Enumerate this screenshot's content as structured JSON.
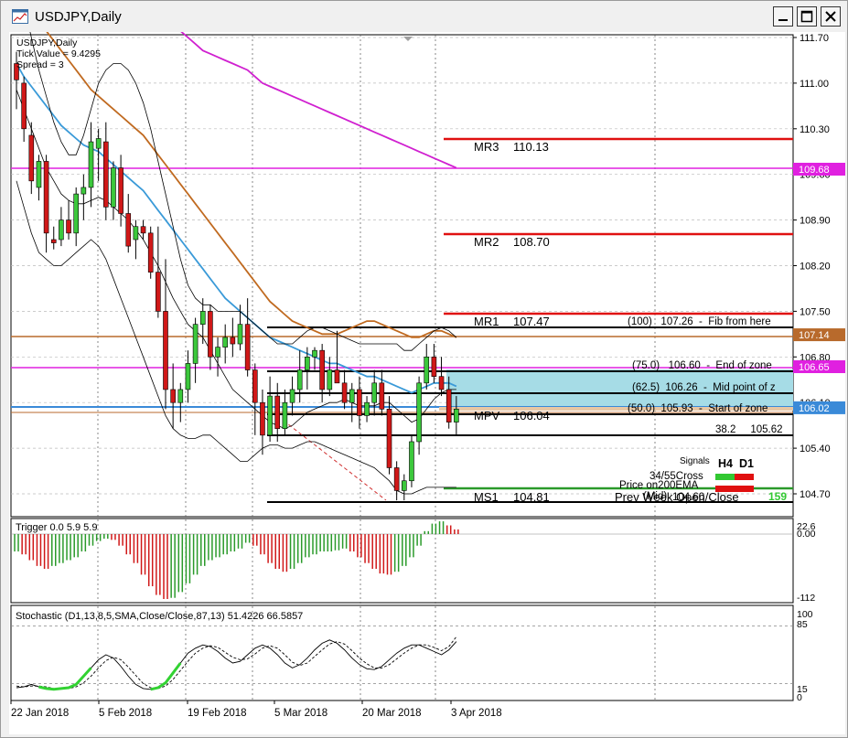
{
  "window": {
    "title": "USDJPY,Daily"
  },
  "chart_data": {
    "type": "candlestick",
    "symbol": "USDJPY,Daily",
    "info_lines": [
      "USDJPY,Daily",
      "Tick Value = 9.4295",
      "Spread = 3"
    ],
    "price_axis": {
      "ticks": [
        "111.70",
        "111.00",
        "110.30",
        "109.60",
        "108.90",
        "108.20",
        "107.50",
        "106.80",
        "106.10",
        "105.40",
        "104.70"
      ],
      "highlighted": [
        {
          "label": "109.68",
          "color": "#e020e0"
        },
        {
          "label": "107.14",
          "color": "#b86a2c"
        },
        {
          "label": "106.65",
          "color": "#e020e0"
        },
        {
          "label": "106.02",
          "color": "#3a8ad8"
        }
      ]
    },
    "date_axis": [
      "22 Jan 2018",
      "5 Feb 2018",
      "19 Feb 2018",
      "5 Mar 2018",
      "20 Mar 2018",
      "3 Apr 2018"
    ],
    "pivot_levels": [
      {
        "label": "MR3",
        "value": "110.13"
      },
      {
        "label": "MR2",
        "value": "108.70"
      },
      {
        "label": "MR1",
        "value": "107.47"
      },
      {
        "label": "MPV",
        "value": "106.04"
      },
      {
        "label": "MS1",
        "value": "104.81"
      }
    ],
    "fib_labels": [
      "(100)   107.26  -  Fib from here",
      "(75.0)   106.60  -  End of zone",
      "(62.5)  106.26  -  Mid point of z",
      "(50.0)  105.93  -  Start of zone",
      "38.2     105.62"
    ],
    "signals": {
      "title": "Signals",
      "columns": [
        "H4",
        "D1"
      ],
      "rows": [
        {
          "label": "34/55Cross",
          "h4": "#32c832",
          "d1": "#e01010"
        },
        {
          "label": "Price on200EMA",
          "h4": "#e01010",
          "d1": "#e01010"
        }
      ],
      "prev_week_text": "Prev Week Open/Close",
      "prev_week_value": "104.60",
      "prev_week_extra": "(Mid)",
      "prev_week_badge": "159"
    },
    "trigger_panel": {
      "label": "Trigger 0.0 5.9 5.9",
      "ticks": [
        "22.6",
        "0.00",
        "-112"
      ]
    },
    "stochastic_panel": {
      "label": "Stochastic (D1,13,8,5,SMA,Close/Close,87,13) 51.4226 66.5857",
      "ticks": [
        "100",
        "85",
        "15",
        "0"
      ]
    },
    "candles": [
      {
        "o": 111.3,
        "h": 111.48,
        "l": 110.6,
        "c": 111.05
      },
      {
        "o": 111.0,
        "h": 111.1,
        "l": 110.1,
        "c": 110.3
      },
      {
        "o": 110.2,
        "h": 110.4,
        "l": 109.3,
        "c": 109.5
      },
      {
        "o": 109.4,
        "h": 109.9,
        "l": 109.2,
        "c": 109.8
      },
      {
        "o": 109.8,
        "h": 109.9,
        "l": 108.4,
        "c": 108.7
      },
      {
        "o": 108.6,
        "h": 108.8,
        "l": 108.45,
        "c": 108.55
      },
      {
        "o": 108.6,
        "h": 109.1,
        "l": 108.5,
        "c": 108.9
      },
      {
        "o": 108.9,
        "h": 109.2,
        "l": 108.6,
        "c": 108.7
      },
      {
        "o": 108.7,
        "h": 109.4,
        "l": 108.5,
        "c": 109.3
      },
      {
        "o": 109.3,
        "h": 109.6,
        "l": 108.9,
        "c": 109.4
      },
      {
        "o": 109.4,
        "h": 110.4,
        "l": 109.1,
        "c": 110.1
      },
      {
        "o": 110.0,
        "h": 110.3,
        "l": 109.5,
        "c": 110.15
      },
      {
        "o": 110.1,
        "h": 110.4,
        "l": 108.9,
        "c": 109.1
      },
      {
        "o": 109.1,
        "h": 109.8,
        "l": 108.9,
        "c": 109.7
      },
      {
        "o": 109.7,
        "h": 109.9,
        "l": 108.8,
        "c": 109.0
      },
      {
        "o": 109.0,
        "h": 109.3,
        "l": 108.4,
        "c": 108.5
      },
      {
        "o": 108.6,
        "h": 108.9,
        "l": 108.3,
        "c": 108.8
      },
      {
        "o": 108.8,
        "h": 108.9,
        "l": 108.6,
        "c": 108.7
      },
      {
        "o": 108.7,
        "h": 108.8,
        "l": 108.0,
        "c": 108.1
      },
      {
        "o": 108.1,
        "h": 108.8,
        "l": 107.4,
        "c": 107.5
      },
      {
        "o": 107.5,
        "h": 108.3,
        "l": 106.0,
        "c": 106.3
      },
      {
        "o": 106.3,
        "h": 106.7,
        "l": 105.7,
        "c": 106.1
      },
      {
        "o": 106.1,
        "h": 106.4,
        "l": 105.8,
        "c": 106.3
      },
      {
        "o": 106.3,
        "h": 106.9,
        "l": 106.1,
        "c": 106.7
      },
      {
        "o": 106.7,
        "h": 107.4,
        "l": 106.4,
        "c": 107.3
      },
      {
        "o": 107.3,
        "h": 107.7,
        "l": 107.0,
        "c": 107.5
      },
      {
        "o": 107.5,
        "h": 107.6,
        "l": 106.6,
        "c": 106.8
      },
      {
        "o": 106.8,
        "h": 107.1,
        "l": 106.5,
        "c": 106.95
      },
      {
        "o": 106.95,
        "h": 107.3,
        "l": 106.7,
        "c": 107.1
      },
      {
        "o": 107.1,
        "h": 107.4,
        "l": 106.8,
        "c": 107.0
      },
      {
        "o": 107.0,
        "h": 107.6,
        "l": 106.9,
        "c": 107.3
      },
      {
        "o": 107.3,
        "h": 107.7,
        "l": 106.5,
        "c": 106.6
      },
      {
        "o": 106.6,
        "h": 106.7,
        "l": 105.6,
        "c": 106.1
      },
      {
        "o": 106.1,
        "h": 106.3,
        "l": 105.3,
        "c": 105.6
      },
      {
        "o": 105.6,
        "h": 106.5,
        "l": 105.5,
        "c": 106.2
      },
      {
        "o": 106.2,
        "h": 106.4,
        "l": 105.5,
        "c": 105.7
      },
      {
        "o": 105.7,
        "h": 106.3,
        "l": 105.6,
        "c": 106.1
      },
      {
        "o": 106.1,
        "h": 106.5,
        "l": 105.9,
        "c": 106.3
      },
      {
        "o": 106.3,
        "h": 106.9,
        "l": 106.1,
        "c": 106.6
      },
      {
        "o": 106.6,
        "h": 106.95,
        "l": 106.3,
        "c": 106.8
      },
      {
        "o": 106.8,
        "h": 106.95,
        "l": 106.6,
        "c": 106.9
      },
      {
        "o": 106.9,
        "h": 107.0,
        "l": 106.1,
        "c": 106.3
      },
      {
        "o": 106.3,
        "h": 106.8,
        "l": 106.2,
        "c": 106.6
      },
      {
        "o": 106.6,
        "h": 107.2,
        "l": 106.4,
        "c": 106.4
      },
      {
        "o": 106.4,
        "h": 106.6,
        "l": 106.0,
        "c": 106.1
      },
      {
        "o": 106.1,
        "h": 106.4,
        "l": 105.8,
        "c": 106.3
      },
      {
        "o": 106.3,
        "h": 106.5,
        "l": 105.7,
        "c": 105.9
      },
      {
        "o": 105.9,
        "h": 106.2,
        "l": 105.8,
        "c": 106.1
      },
      {
        "o": 106.1,
        "h": 106.6,
        "l": 105.9,
        "c": 106.4
      },
      {
        "o": 106.4,
        "h": 106.6,
        "l": 105.9,
        "c": 106.0
      },
      {
        "o": 106.0,
        "h": 106.2,
        "l": 105.0,
        "c": 105.1
      },
      {
        "o": 105.1,
        "h": 105.2,
        "l": 104.6,
        "c": 104.75
      },
      {
        "o": 104.75,
        "h": 105.0,
        "l": 104.6,
        "c": 104.9
      },
      {
        "o": 104.9,
        "h": 105.6,
        "l": 104.8,
        "c": 105.5
      },
      {
        "o": 105.5,
        "h": 106.5,
        "l": 105.3,
        "c": 106.4
      },
      {
        "o": 106.4,
        "h": 107.0,
        "l": 106.3,
        "c": 106.8
      },
      {
        "o": 106.8,
        "h": 107.0,
        "l": 106.4,
        "c": 106.5
      },
      {
        "o": 106.5,
        "h": 106.8,
        "l": 106.2,
        "c": 106.3
      },
      {
        "o": 106.3,
        "h": 106.5,
        "l": 105.7,
        "c": 105.8
      },
      {
        "o": 105.8,
        "h": 106.2,
        "l": 105.6,
        "c": 106.0
      }
    ],
    "ma_black": [
      110.9,
      110.6,
      110.3,
      110.0,
      109.7,
      109.5,
      109.3,
      109.2,
      109.15,
      109.15,
      109.2,
      109.25,
      109.2,
      109.1,
      109.0,
      108.9,
      108.75,
      108.6,
      108.4,
      108.2,
      107.95,
      107.7,
      107.5,
      107.3,
      107.2,
      107.1,
      106.9,
      106.7,
      106.5,
      106.3,
      106.2,
      106.1,
      106.0,
      105.9,
      105.8,
      105.75,
      105.7,
      105.75,
      105.85,
      105.95,
      106.0,
      106.05,
      106.1,
      106.1,
      106.15,
      106.1,
      106.05,
      106.05,
      106.05,
      106.1,
      106.1,
      106.0,
      105.9,
      105.8,
      105.85,
      106.0,
      106.15,
      106.25,
      106.3,
      106.3
    ],
    "ema_blue": [
      111.3,
      111.1,
      110.95,
      110.8,
      110.65,
      110.5,
      110.35,
      110.25,
      110.15,
      110.05,
      110.0,
      109.95,
      109.85,
      109.75,
      109.65,
      109.55,
      109.45,
      109.35,
      109.2,
      109.05,
      108.9,
      108.75,
      108.6,
      108.45,
      108.3,
      108.15,
      108.0,
      107.85,
      107.7,
      107.6,
      107.5,
      107.4,
      107.3,
      107.2,
      107.1,
      107.05,
      107.0,
      106.95,
      106.9,
      106.85,
      106.8,
      106.75,
      106.7,
      106.7,
      106.65,
      106.6,
      106.55,
      106.5,
      106.5,
      106.45,
      106.4,
      106.35,
      106.3,
      106.25,
      106.3,
      106.35,
      106.4,
      106.4,
      106.4,
      106.35
    ],
    "ema_brown": [
      112.5,
      112.3,
      112.1,
      111.95,
      111.8,
      111.65,
      111.5,
      111.35,
      111.2,
      111.05,
      110.9,
      110.8,
      110.7,
      110.6,
      110.5,
      110.4,
      110.3,
      110.2,
      110.05,
      109.9,
      109.75,
      109.6,
      109.45,
      109.3,
      109.15,
      109.0,
      108.85,
      108.7,
      108.55,
      108.4,
      108.25,
      108.1,
      107.95,
      107.8,
      107.65,
      107.55,
      107.45,
      107.35,
      107.3,
      107.25,
      107.2,
      107.15,
      107.15,
      107.15,
      107.2,
      107.25,
      107.3,
      107.35,
      107.35,
      107.3,
      107.25,
      107.2,
      107.15,
      107.1,
      107.1,
      107.15,
      107.2,
      107.2,
      107.15,
      107.1
    ],
    "ema_magenta": [
      113.6,
      113.5,
      113.4,
      113.3,
      113.2,
      113.1,
      113.0,
      112.9,
      112.8,
      112.75,
      112.7,
      112.65,
      112.6,
      112.55,
      112.5,
      112.45,
      112.4,
      112.3,
      112.2,
      112.1,
      112.0,
      111.9,
      111.8,
      111.7,
      111.6,
      111.5,
      111.45,
      111.4,
      111.35,
      111.3,
      111.25,
      111.2,
      111.1,
      111.0,
      110.95,
      110.9,
      110.85,
      110.8,
      110.75,
      110.7,
      110.65,
      110.6,
      110.55,
      110.5,
      110.45,
      110.4,
      110.35,
      110.3,
      110.25,
      110.2,
      110.15,
      110.1,
      110.05,
      110.0,
      109.95,
      109.9,
      109.85,
      109.8,
      109.75,
      109.7
    ],
    "env_upper": [
      112.6,
      112.2,
      111.7,
      111.2,
      110.8,
      110.4,
      110.1,
      109.9,
      109.9,
      110.2,
      110.6,
      111.0,
      111.2,
      111.3,
      111.3,
      111.2,
      111.0,
      110.7,
      110.3,
      109.8,
      109.3,
      108.8,
      108.3,
      107.9,
      107.7,
      107.6,
      107.6,
      107.5,
      107.5,
      107.5,
      107.5,
      107.4,
      107.3,
      107.2,
      107.1,
      107.0,
      107.0,
      107.0,
      107.1,
      107.2,
      107.25,
      107.25,
      107.2,
      107.15,
      107.1,
      107.05,
      107.0,
      107.0,
      107.0,
      107.0,
      107.0,
      107.0,
      106.9,
      106.9,
      107.0,
      107.1,
      107.2,
      107.25,
      107.2,
      107.1
    ],
    "env_lower": [
      109.5,
      109.1,
      108.7,
      108.4,
      108.3,
      108.2,
      108.2,
      108.3,
      108.4,
      108.5,
      108.6,
      108.5,
      108.3,
      108.0,
      107.7,
      107.4,
      107.1,
      106.8,
      106.5,
      106.2,
      105.9,
      105.7,
      105.6,
      105.55,
      105.55,
      105.6,
      105.6,
      105.5,
      105.4,
      105.3,
      105.2,
      105.2,
      105.3,
      105.4,
      105.45,
      105.45,
      105.4,
      105.4,
      105.45,
      105.5,
      105.5,
      105.45,
      105.4,
      105.35,
      105.3,
      105.25,
      105.2,
      105.15,
      105.1,
      105.0,
      104.9,
      104.75,
      104.7,
      104.7,
      104.75,
      104.8,
      104.8,
      104.8,
      104.8,
      104.8
    ],
    "trigger_hist": [
      -30,
      -35,
      -45,
      -55,
      -60,
      -55,
      -50,
      -45,
      -40,
      -30,
      -20,
      -12,
      -8,
      -10,
      -20,
      -35,
      -50,
      -70,
      -90,
      -105,
      -112,
      -110,
      -100,
      -85,
      -70,
      -55,
      -45,
      -40,
      -35,
      -30,
      -25,
      -15,
      -20,
      -35,
      -50,
      -60,
      -65,
      -60,
      -50,
      -40,
      -35,
      -30,
      -30,
      -28,
      -25,
      -30,
      -40,
      -50,
      -60,
      -68,
      -70,
      -65,
      -55,
      -40,
      -20,
      5,
      18,
      22,
      15,
      8
    ],
    "stoch_main": [
      10,
      11,
      14,
      11,
      9,
      8,
      9,
      10,
      14,
      24,
      34,
      44,
      50,
      46,
      36,
      24,
      14,
      9,
      8,
      10,
      16,
      28,
      40,
      52,
      58,
      62,
      60,
      54,
      46,
      40,
      42,
      50,
      58,
      62,
      58,
      50,
      40,
      34,
      38,
      46,
      56,
      64,
      68,
      64,
      56,
      46,
      38,
      33,
      32,
      36,
      44,
      52,
      58,
      62,
      62,
      58,
      54,
      50,
      56,
      66
    ],
    "stoch_signal": [
      12,
      11,
      12,
      12,
      11,
      9,
      9,
      9,
      11,
      16,
      24,
      34,
      43,
      47,
      44,
      35,
      25,
      15,
      10,
      9,
      12,
      20,
      31,
      42,
      52,
      58,
      61,
      59,
      53,
      47,
      44,
      45,
      51,
      58,
      61,
      58,
      50,
      41,
      37,
      40,
      48,
      56,
      63,
      66,
      63,
      55,
      46,
      39,
      34,
      34,
      38,
      45,
      52,
      58,
      62,
      62,
      59,
      55,
      60,
      72
    ],
    "stoch_green_ranges": [
      [
        3,
        10
      ],
      [
        18,
        22
      ]
    ]
  }
}
